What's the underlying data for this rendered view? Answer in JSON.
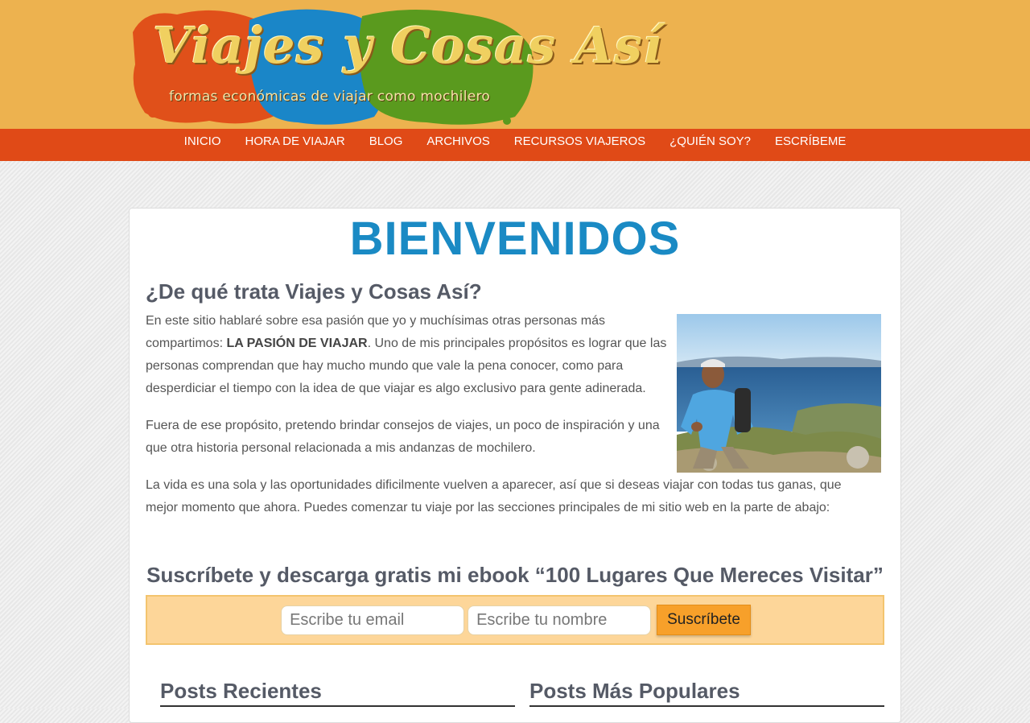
{
  "header": {
    "logo_title": "Viajes y Cosas Así",
    "logo_tagline": "formas económicas de viajar como mochilero"
  },
  "nav": {
    "items": [
      "INICIO",
      "HORA DE VIAJAR",
      "BLOG",
      "ARCHIVOS",
      "RECURSOS VIAJEROS",
      "¿QUIÉN SOY?",
      "ESCRÍBEME"
    ]
  },
  "main": {
    "welcome": "BIENVENIDOS",
    "heading": "¿De qué trata Viajes y Cosas Así?",
    "p1_before": "En este sitio hablaré sobre esa pasión que yo y muchísimas otras personas más compartimos: ",
    "p1_bold": "LA PASIÓN DE VIAJAR",
    "p1_after": ". Uno de mis principales propósitos es lograr que las personas comprendan que hay mucho mundo que vale la pena conocer, como para desperdiciar el tiempo con la idea de que viajar es algo exclusivo para gente adinerada.",
    "p2": "Fuera de ese propósito, pretendo brindar consejos de viajes, un poco de inspiración y una que otra historia personal relacionada a mis andanzas de mochilero.",
    "p3": "La vida es una sola y las oportunidades dificilmente vuelven a aparecer, así que si deseas viajar con todas tus ganas, que mejor momento que ahora. Puedes comenzar tu viaje por las secciones principales de mi sitio web en la parte de abajo:"
  },
  "subscribe": {
    "title": "Suscríbete y descarga gratis mi ebook “100 Lugares Que Mereces Visitar”",
    "email_placeholder": "Escribe tu email",
    "name_placeholder": "Escribe tu nombre",
    "button_label": "Suscríbete"
  },
  "sections": {
    "recent": "Posts Recientes",
    "popular": "Posts Más Populares"
  },
  "colors": {
    "header_bg": "#edb24f",
    "nav_bg": "#e04a17",
    "accent_blue": "#1a8ac4",
    "subscribe_bg": "#fdd699",
    "button_bg": "#f7a02a"
  }
}
